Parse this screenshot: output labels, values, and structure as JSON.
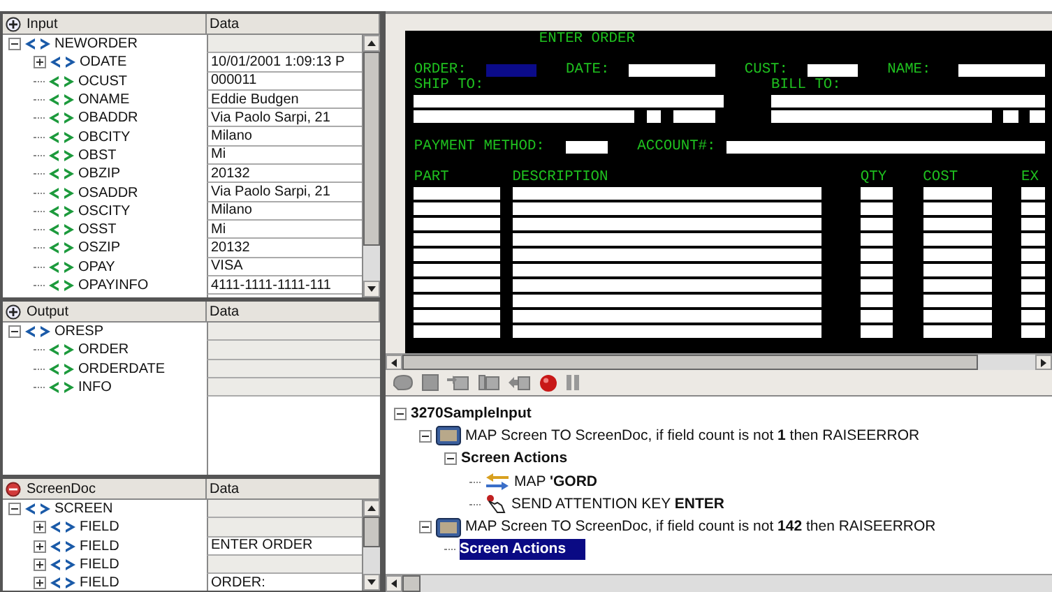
{
  "input_panel": {
    "title": "Input",
    "expanded": false,
    "column": "Data",
    "nodes": [
      {
        "name": "NEWORDER",
        "expanded": true,
        "children": [
          {
            "name": "ODATE",
            "data": "10/01/2001 1:09:13 P",
            "expanded": false
          },
          {
            "name": "OCUST",
            "data": "000011"
          },
          {
            "name": "ONAME",
            "data": "Eddie Budgen"
          },
          {
            "name": "OBADDR",
            "data": "Via Paolo Sarpi, 21"
          },
          {
            "name": "OBCITY",
            "data": "Milano"
          },
          {
            "name": "OBST",
            "data": "Mi"
          },
          {
            "name": "OBZIP",
            "data": "20132"
          },
          {
            "name": "OSADDR",
            "data": "Via Paolo Sarpi, 21"
          },
          {
            "name": "OSCITY",
            "data": "Milano"
          },
          {
            "name": "OSST",
            "data": "Mi"
          },
          {
            "name": "OSZIP",
            "data": "20132"
          },
          {
            "name": "OPAY",
            "data": "VISA"
          },
          {
            "name": "OPAYINFO",
            "data": "4111-1111-1111-111"
          }
        ]
      }
    ]
  },
  "output_panel": {
    "title": "Output",
    "expanded": false,
    "column": "Data",
    "nodes": [
      {
        "name": "ORESP",
        "expanded": true,
        "children": [
          {
            "name": "ORDER"
          },
          {
            "name": "ORDERDATE"
          },
          {
            "name": "INFO"
          }
        ]
      }
    ]
  },
  "screendoc_panel": {
    "title": "ScreenDoc",
    "expanded": true,
    "column": "Data",
    "nodes": [
      {
        "name": "SCREEN",
        "expanded": true,
        "children": [
          {
            "name": "FIELD",
            "expanded": false
          },
          {
            "name": "FIELD",
            "data": "ENTER ORDER",
            "expanded": false
          },
          {
            "name": "FIELD",
            "expanded": false
          },
          {
            "name": "FIELD",
            "data": "ORDER:",
            "expanded": false
          }
        ]
      }
    ]
  },
  "terminal": {
    "title": "ENTER ORDER",
    "order_field": {
      "focused": true
    },
    "labels": [
      "ORDER:",
      "DATE:",
      "CUST:",
      "NAME:",
      "SHIP TO:",
      "BILL TO:",
      "PAYMENT METHOD:",
      "ACCOUNT#:",
      "PART",
      "DESCRIPTION",
      "QTY",
      "COST",
      "EX"
    ]
  },
  "actions_tree": {
    "nodes": [
      {
        "kind": "root",
        "text": "3270SampleInput",
        "selected": false,
        "expanded": true,
        "children": [
          {
            "kind": "map-screen",
            "text": "MAP Screen TO ScreenDoc, if field count is not **1** then RAISEERROR",
            "selected": false,
            "expanded": true,
            "children": [
              {
                "kind": "group",
                "text": "Screen Actions",
                "selected": false,
                "expanded": true,
                "children": [
                  {
                    "kind": "map",
                    "text": "MAP **'GORD**",
                    "selected": false
                  },
                  {
                    "kind": "key",
                    "text": "SEND ATTENTION KEY **ENTER**",
                    "selected": false
                  }
                ]
              }
            ]
          },
          {
            "kind": "map-screen",
            "text": "MAP Screen TO ScreenDoc, if field count is not **142** then RAISEERROR",
            "selected": false,
            "expanded": true,
            "children": [
              {
                "kind": "group",
                "text": "Screen Actions",
                "selected": true
              }
            ]
          }
        ]
      }
    ]
  }
}
